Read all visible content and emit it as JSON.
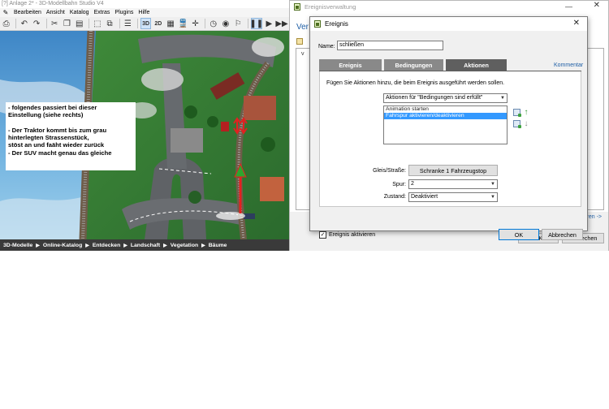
{
  "app": {
    "title": "[?] Anlage 2* - 3D-Modellbahn Studio V4",
    "menu": [
      "Bearbeiten",
      "Ansicht",
      "Katalog",
      "Extras",
      "Plugins",
      "Hilfe"
    ],
    "toolbar": {
      "mode_3d": "3D",
      "mode_2d": "2D"
    },
    "note_lines": [
      "- folgendes passiert bei dieser",
      "Einstellung (siehe rechts)",
      "",
      "- Der Traktor kommt bis zum grau",
      "hinterlegten Strassenstück,",
      "stöst an und faäht wieder zurück",
      "- Der SUV macht genau das gleiche"
    ],
    "bottom_nav": [
      "3D-Modelle",
      "Online-Katalog",
      "Entdecken",
      "Landschaft",
      "Vegetation",
      "Bäume"
    ]
  },
  "ev_window": {
    "title": "Ereignisverwaltung",
    "heading": "Ver",
    "list_first": "v",
    "link": "ren ->",
    "ok": "OK",
    "cancel": "Abbrechen"
  },
  "dialog": {
    "title": "Ereignis",
    "name_label": "Name:",
    "name_value": "schließen",
    "tabs": {
      "ereignis": "Ereignis",
      "bedingungen": "Bedingungen",
      "aktionen": "Aktionen"
    },
    "kommentar": "Kommentar",
    "description": "Fügen Sie Aktionen hinzu, die beim Ereignis ausgeführt werden sollen.",
    "aktionen_select": "Aktionen für \"Bedingungen sind erfüllt\"",
    "actions": [
      "Animation starten",
      "Fahrspur aktivieren/deaktivieren"
    ],
    "gleis_label": "Gleis/Straße:",
    "gleis_value": "Schranke 1 Fahrzeugstop",
    "spur_label": "Spur:",
    "spur_value": "2",
    "zustand_label": "Zustand:",
    "zustand_value": "Deaktiviert",
    "checkbox_label": "Ereignis aktivieren",
    "ok": "OK",
    "cancel": "Abbrechen"
  },
  "colors": {
    "tab_active": "#5f5f5f",
    "tab_inactive": "#898989",
    "selection": "#3399ff",
    "link": "#1f5fa6",
    "nav_bar": "#3a3a3a"
  }
}
